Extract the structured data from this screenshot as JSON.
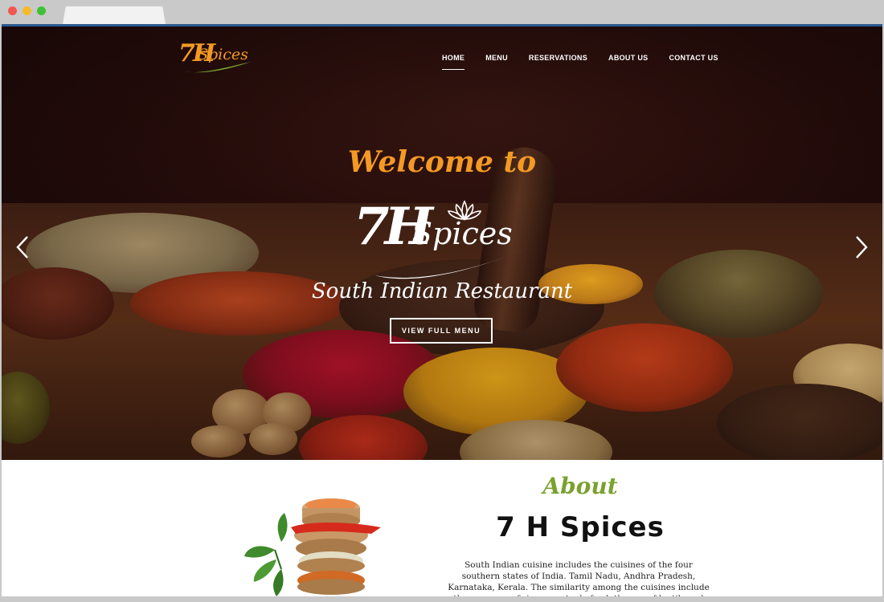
{
  "nav": {
    "items": [
      {
        "label": "HOME",
        "active": true
      },
      {
        "label": "MENU",
        "active": false
      },
      {
        "label": "RESERVATIONS",
        "active": false
      },
      {
        "label": "ABOUT US",
        "active": false
      },
      {
        "label": "CONTACT US",
        "active": false
      }
    ]
  },
  "logo": {
    "mark": "7H",
    "word": "Spices"
  },
  "hero": {
    "welcome": "Welcome to",
    "brand_mark": "7H",
    "brand_word": "Spices",
    "tagline": "South Indian Restaurant",
    "button": "VIEW FULL MENU",
    "prev_icon": "chevron-left-icon",
    "next_icon": "chevron-right-icon"
  },
  "about": {
    "heading": "About",
    "title": "7 H Spices",
    "text": "South Indian cuisine includes the cuisines of the four southern states of India. Tamil Nadu, Andhra Pradesh, Karnataka, Kerala. The similarity among the cuisines include the presence of rice as a staple food, the use of lentils and spices, dried red chilies and fresh green"
  },
  "colors": {
    "accent_orange": "#f49a24",
    "accent_green": "#7aa12e",
    "hero_dark": "#240c0a"
  }
}
